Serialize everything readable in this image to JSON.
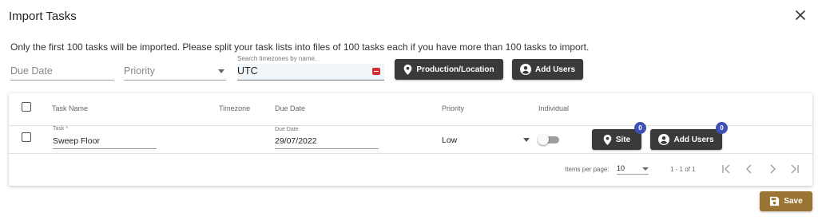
{
  "dialog": {
    "title": "Import Tasks",
    "close_icon": "close-icon",
    "note": "Only the first 100 tasks will be imported. Please split your task lists into files of 100 tasks each if you have more than 100 tasks to import."
  },
  "filters": {
    "due_date_placeholder": "Due Date",
    "priority_placeholder": "Priority",
    "timezone_label": "Search timezones by name.",
    "timezone_value": "UTC",
    "production_button": "Production/Location",
    "add_users_button": "Add Users"
  },
  "table": {
    "headers": [
      "Task Name",
      "Timezone",
      "Due Date",
      "Priority",
      "Individual"
    ],
    "rows": [
      {
        "task_label": "Task *",
        "task_value": "Sweep Floor",
        "due_date_label": "Due Date",
        "due_date_value": "29/07/2022",
        "priority": "Low",
        "individual": false,
        "site_button": "Site",
        "site_badge": "0",
        "add_users_button": "Add Users",
        "users_badge": "0"
      }
    ]
  },
  "paginator": {
    "items_per_page_label": "Items per page:",
    "items_per_page": "10",
    "range": "1 - 1 of 1"
  },
  "actions": {
    "save": "Save"
  },
  "colors": {
    "dark_button": "#3a3a3a",
    "save_button": "#9a7432",
    "badge": "#3f51b5",
    "timezone_icon": "#d32f2f"
  }
}
